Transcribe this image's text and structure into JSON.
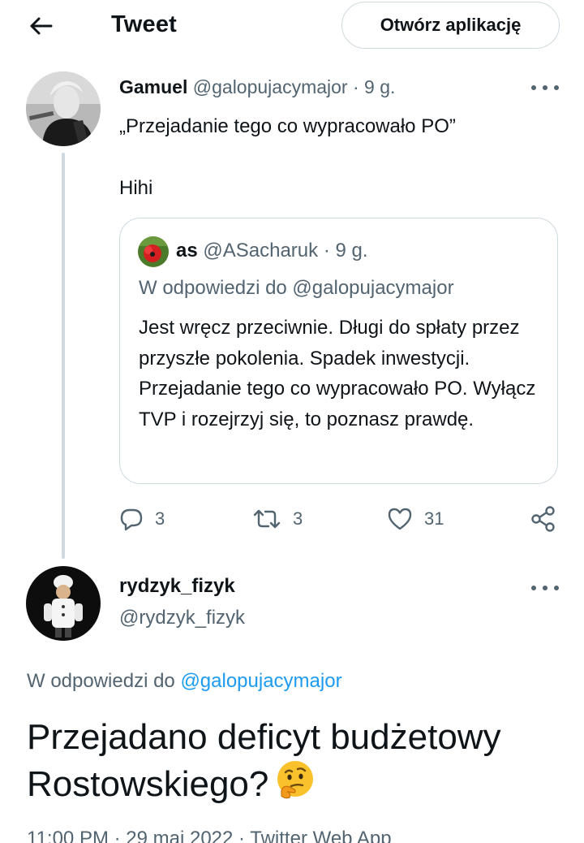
{
  "header": {
    "title": "Tweet",
    "open_app": "Otwórz aplikację"
  },
  "tweet": {
    "author_name": "Gamuel",
    "author_handle": "@galopujacymajor",
    "separator": "·",
    "time": "9 g.",
    "text": "„Przejadanie tego co wypracowało PO”\n\nHihi",
    "quote": {
      "author_name": "as",
      "author_handle": "@ASacharuk",
      "separator": "·",
      "time": "9 g.",
      "reply_to": "W odpowiedzi do @galopujacymajor",
      "text": "Jest wręcz przeciwnie. Długi do spłaty przez przyszłe pokolenia. Spadek inwestycji. Przejadanie tego co wypracowało PO. Wyłącz TVP i rozejrzyj się, to poznasz prawdę."
    },
    "actions": {
      "replies": "3",
      "retweets": "3",
      "likes": "31"
    }
  },
  "reply": {
    "author_name": "rydzyk_fizyk",
    "author_handle": "@rydzyk_fizyk",
    "reply_to_prefix": "W odpowiedzi do",
    "reply_to_handle": "@galopujacymajor",
    "text": "Przejadano deficyt budżetowy Rostowskiego?",
    "emoji": "thinking-face",
    "meta": "11:00 PM · 29 maj 2022 · Twitter Web App"
  },
  "colors": {
    "text": "#0f1419",
    "muted": "#536471",
    "link": "#1d9bf0",
    "border": "#cfd9de"
  },
  "icons": {
    "back": "arrow-left-icon",
    "more": "more-horizontal-icon",
    "reply": "comment-icon",
    "retweet": "retweet-icon",
    "like": "heart-icon",
    "share": "share-icon"
  }
}
